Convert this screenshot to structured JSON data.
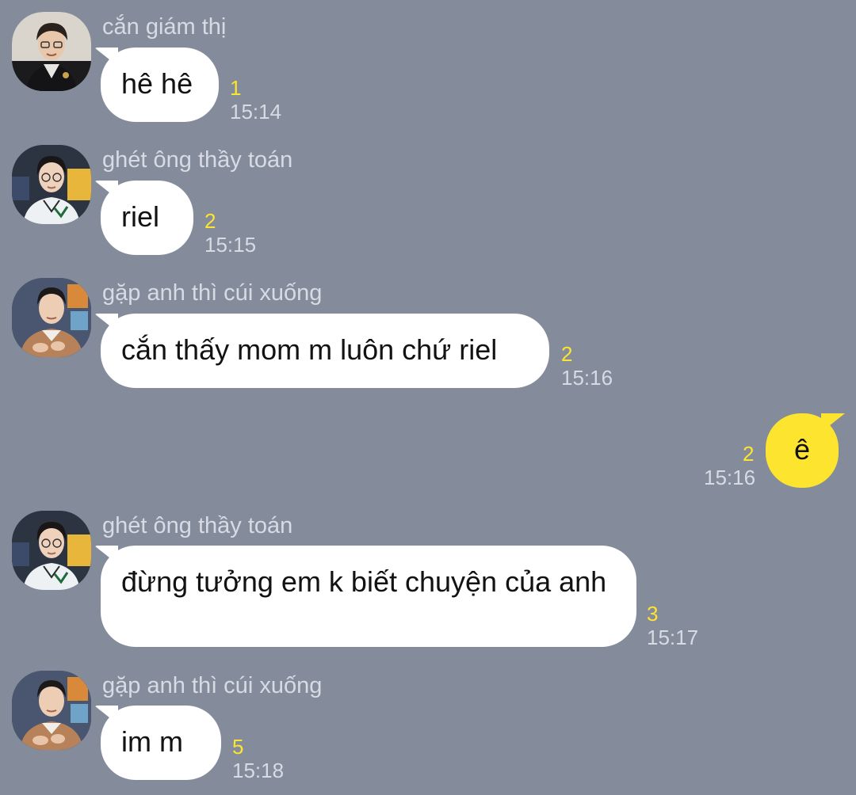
{
  "messages": [
    {
      "sender": "cắn giám thị",
      "text": "hê hê",
      "unread": "1",
      "time": "15:14"
    },
    {
      "sender": "ghét ông thầy toán",
      "text": "riel",
      "unread": "2",
      "time": "15:15"
    },
    {
      "sender": "gặp anh thì cúi xuống",
      "text": "cắn thấy mom m luôn chứ riel",
      "unread": "2",
      "time": "15:16"
    },
    {
      "sender": "",
      "text": "ê",
      "unread": "2",
      "time": "15:16"
    },
    {
      "sender": "ghét ông thầy toán",
      "text": "đừng tưởng em k biết chuyện của anh",
      "unread": "3",
      "time": "15:17"
    },
    {
      "sender": "gặp anh thì cúi xuống",
      "text": "im m",
      "unread": "5",
      "time": "15:18"
    }
  ],
  "colors": {
    "background": "#848c9c",
    "incoming_bubble": "#ffffff",
    "outgoing_bubble": "#fde42e",
    "unread_count": "#fde42e",
    "meta_text": "#d7dbe3"
  },
  "icons": {
    "avatar_1": "profile-photo",
    "avatar_2": "profile-photo",
    "avatar_3": "profile-photo"
  }
}
